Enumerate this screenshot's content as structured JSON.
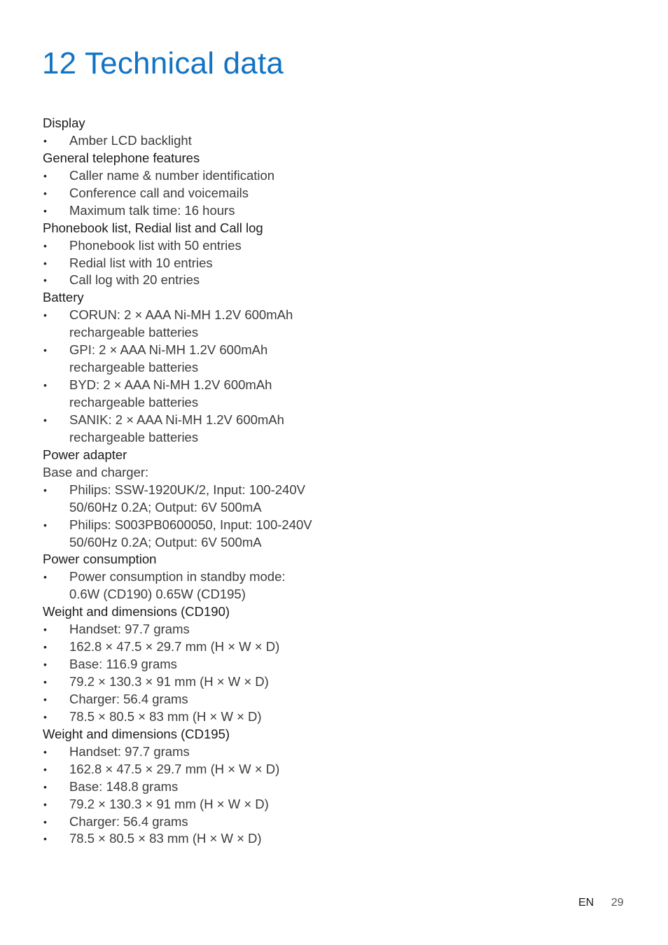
{
  "page": {
    "title": "12 Technical data",
    "footer": {
      "language": "EN",
      "page_number": "29"
    }
  },
  "sections": [
    {
      "heading": "Display",
      "items": [
        [
          "Amber LCD backlight"
        ]
      ]
    },
    {
      "heading": "General telephone features",
      "items": [
        [
          "Caller name & number identification"
        ],
        [
          "Conference call and voicemails"
        ],
        [
          "Maximum talk time: 16 hours"
        ]
      ]
    },
    {
      "heading": "Phonebook list, Redial list and Call log",
      "items": [
        [
          "Phonebook list with 50 entries"
        ],
        [
          "Redial list with 10 entries"
        ],
        [
          "Call log with 20 entries"
        ]
      ]
    },
    {
      "heading": "Battery",
      "items": [
        [
          "CORUN: 2 × AAA Ni-MH 1.2V 600mAh",
          "rechargeable batteries"
        ],
        [
          "GPI: 2 × AAA Ni-MH 1.2V 600mAh",
          "rechargeable batteries"
        ],
        [
          "BYD: 2 × AAA Ni-MH 1.2V 600mAh",
          "rechargeable batteries"
        ],
        [
          "SANIK: 2 × AAA Ni-MH 1.2V 600mAh",
          "rechargeable batteries"
        ]
      ]
    },
    {
      "heading": "Power adapter",
      "subtext": "Base and charger:",
      "items": [
        [
          "Philips: SSW-1920UK/2, Input: 100-240V",
          "50/60Hz 0.2A; Output: 6V 500mA"
        ],
        [
          "Philips: S003PB0600050, Input: 100-240V",
          "50/60Hz 0.2A; Output: 6V 500mA"
        ]
      ]
    },
    {
      "heading": "Power consumption",
      "items": [
        [
          "Power consumption in standby mode:",
          "0.6W (CD190) 0.65W (CD195)"
        ]
      ]
    },
    {
      "heading": "Weight and dimensions (CD190)",
      "items": [
        [
          "Handset: 97.7 grams"
        ],
        [
          "162.8 × 47.5 × 29.7 mm (H × W × D)"
        ],
        [
          "Base: 116.9 grams"
        ],
        [
          "79.2 × 130.3 × 91 mm (H × W × D)"
        ],
        [
          "Charger: 56.4 grams"
        ],
        [
          "78.5 × 80.5 × 83 mm (H × W × D)"
        ]
      ]
    },
    {
      "heading": "Weight and dimensions (CD195)",
      "items": [
        [
          "Handset: 97.7 grams"
        ],
        [
          "162.8 × 47.5 × 29.7 mm (H × W × D)"
        ],
        [
          "Base: 148.8 grams"
        ],
        [
          "79.2 × 130.3 × 91 mm (H × W × D)"
        ],
        [
          "Charger: 56.4 grams"
        ],
        [
          "78.5 × 80.5 × 83 mm (H × W × D)"
        ]
      ]
    }
  ]
}
